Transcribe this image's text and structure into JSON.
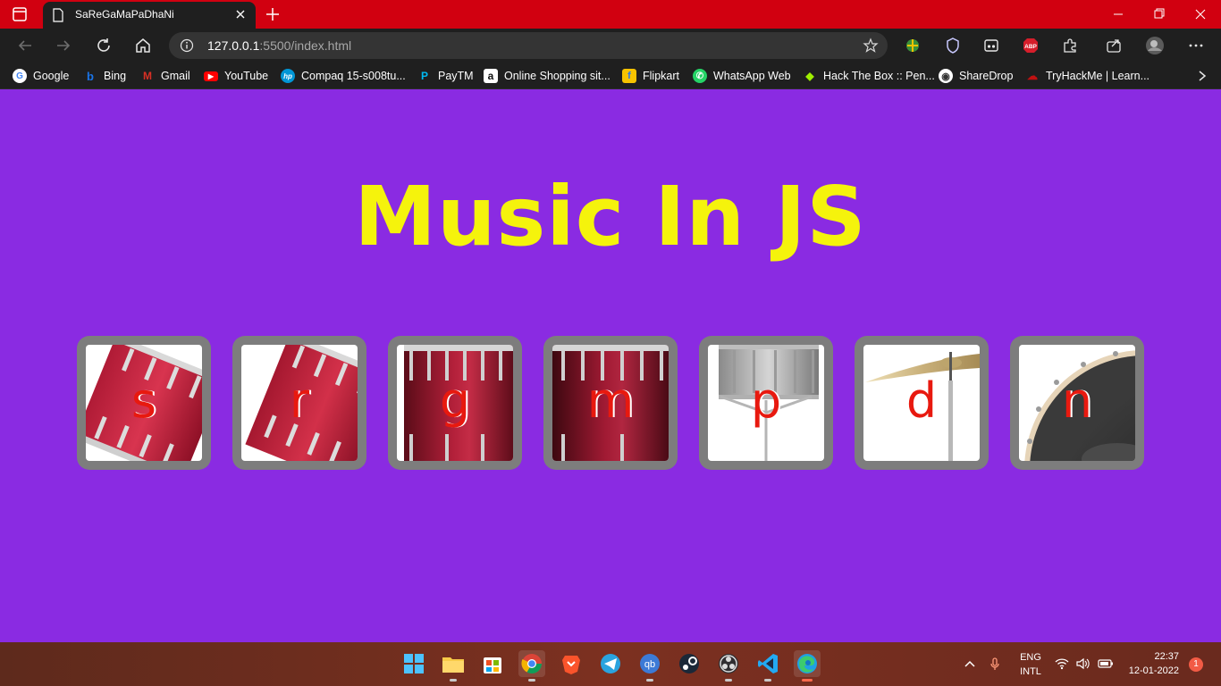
{
  "browser": {
    "tab_title": "SaReGaMaPaDhaNi",
    "url_host": "127.0.0.1",
    "url_rest": ":5500/index.html"
  },
  "bookmarks": [
    {
      "label": "Google",
      "color": "#ffffff",
      "glyph": "G"
    },
    {
      "label": "Bing",
      "color": "#1a74e8",
      "glyph": "b"
    },
    {
      "label": "Gmail",
      "color": "#d93025",
      "glyph": "M"
    },
    {
      "label": "YouTube",
      "color": "#ff0000",
      "glyph": "▶"
    },
    {
      "label": "Compaq 15-s008tu...",
      "color": "#0096d6",
      "glyph": "hp"
    },
    {
      "label": "PayTM",
      "color": "#00baf2",
      "glyph": "P"
    },
    {
      "label": "Online Shopping sit...",
      "color": "#ffffff",
      "glyph": "a"
    },
    {
      "label": "Flipkart",
      "color": "#f7c300",
      "glyph": "f"
    },
    {
      "label": "WhatsApp Web",
      "color": "#25d366",
      "glyph": "✆"
    },
    {
      "label": "Hack The Box :: Pen...",
      "color": "#9fef00",
      "glyph": "◆"
    },
    {
      "label": "ShareDrop",
      "color": "#ffffff",
      "glyph": "◉"
    },
    {
      "label": "TryHackMe | Learn...",
      "color": "#c11111",
      "glyph": "☁"
    }
  ],
  "page": {
    "heading": "Music In JS",
    "drums": [
      {
        "key": "s"
      },
      {
        "key": "r"
      },
      {
        "key": "g"
      },
      {
        "key": "m"
      },
      {
        "key": "p"
      },
      {
        "key": "d"
      },
      {
        "key": "n"
      }
    ]
  },
  "taskbar": {
    "lang": "ENG",
    "layout": "INTL",
    "time": "22:37",
    "date": "12-01-2022",
    "notifications": "1"
  },
  "colors": {
    "page_bg": "#8a2be2",
    "heading": "#f5f30c",
    "key": "#e8190f",
    "browser_accent": "#d10010"
  }
}
